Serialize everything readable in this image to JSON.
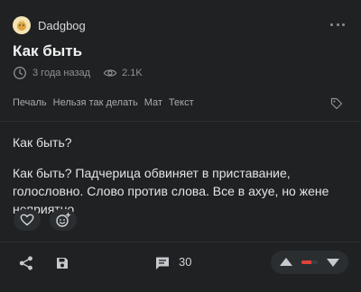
{
  "post": {
    "author": "Dadgbog",
    "title": "Как быть",
    "time_ago": "3 года назад",
    "views": "2.1K",
    "tags": [
      "Печаль",
      "Нельзя так делать",
      "Мат",
      "Текст"
    ],
    "paragraphs": [
      "Как быть?",
      "Как быть? Падчерица обвиняет в приставание, голословно. Слово против слова. Все в ахуе, но жене неприятно"
    ],
    "comments_count": "30",
    "rating_fill_fraction": 0.6
  },
  "icons": {
    "avatar": "avatar-icon",
    "more": "more-dots-icon",
    "time": "clock-icon",
    "views": "eye-icon",
    "tag": "tag-icon",
    "like": "heart-icon",
    "emoji": "add-emoji-icon",
    "share": "share-icon",
    "save": "save-icon",
    "comments": "comment-icon",
    "vote_up": "arrow-up-icon",
    "vote_down": "arrow-down-icon"
  },
  "colors": {
    "background": "#1f2123",
    "accent_red": "#e0423a",
    "muted_text": "#8f9297"
  }
}
